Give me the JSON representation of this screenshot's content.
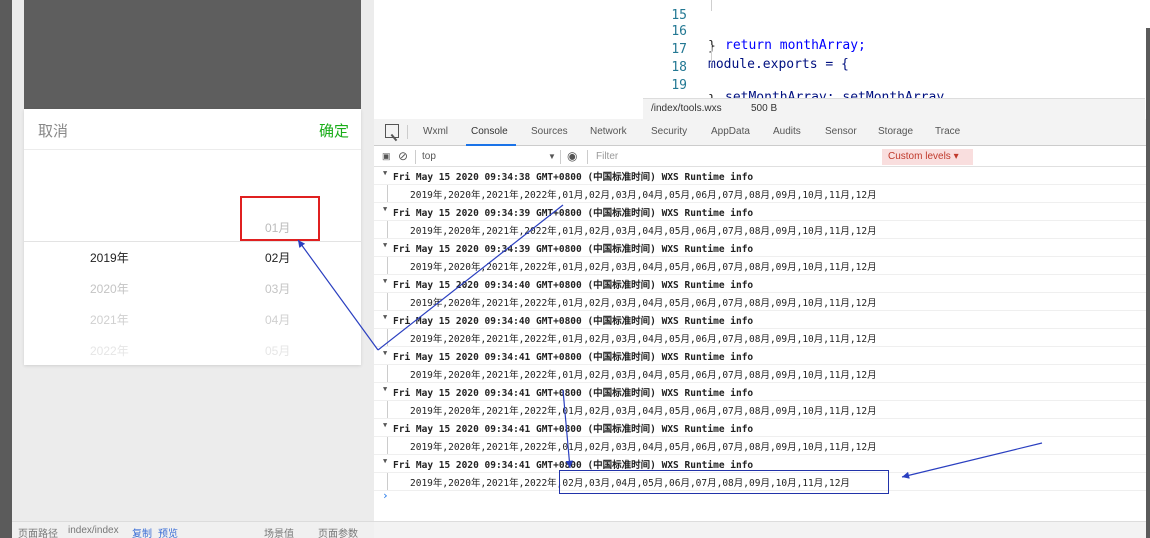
{
  "picker": {
    "cancel": "取消",
    "confirm": "确定",
    "selected_month_above": "01月",
    "rows": [
      {
        "year": "2019年",
        "month": "02月"
      },
      {
        "year": "2020年",
        "month": "03月"
      },
      {
        "year": "2021年",
        "month": "04月"
      },
      {
        "year": "2022年",
        "month": "05月"
      }
    ]
  },
  "sim_footer": {
    "path_label": "页面路径",
    "path": "index/index",
    "copy": "复制",
    "preview": "预览",
    "scene": "场景值",
    "params": "页面参数"
  },
  "editor": {
    "lines": [
      {
        "num": "15",
        "code": "return monthArray;"
      },
      {
        "num": "16",
        "code": "}"
      },
      {
        "num": "17",
        "code": "module.exports = {"
      },
      {
        "num": "18",
        "code": "setMonthArray: setMonthArray"
      },
      {
        "num": "19",
        "code": "}"
      }
    ],
    "file": "/index/tools.wxs",
    "size": "500 B"
  },
  "close_icon": "×",
  "devtools": {
    "tabs": [
      "Wxml",
      "Console",
      "Sources",
      "Network",
      "Security",
      "AppData",
      "Audits",
      "Sensor",
      "Storage",
      "Trace"
    ],
    "active_tab": "Console",
    "context": "top",
    "filter_placeholder": "Filter",
    "levels": "Custom levels ▾"
  },
  "console": {
    "logs": [
      {
        "header": "Fri May 15 2020 09:34:38 GMT+0800 (中国标准时间) WXS Runtime info",
        "body": "2019年,2020年,2021年,2022年,01月,02月,03月,04月,05月,06月,07月,08月,09月,10月,11月,12月"
      },
      {
        "header": "Fri May 15 2020 09:34:39 GMT+0800 (中国标准时间) WXS Runtime info",
        "body": "2019年,2020年,2021年,2022年,01月,02月,03月,04月,05月,06月,07月,08月,09月,10月,11月,12月"
      },
      {
        "header": "Fri May 15 2020 09:34:39 GMT+0800 (中国标准时间) WXS Runtime info",
        "body": "2019年,2020年,2021年,2022年,01月,02月,03月,04月,05月,06月,07月,08月,09月,10月,11月,12月"
      },
      {
        "header": "Fri May 15 2020 09:34:40 GMT+0800 (中国标准时间) WXS Runtime info",
        "body": "2019年,2020年,2021年,2022年,01月,02月,03月,04月,05月,06月,07月,08月,09月,10月,11月,12月"
      },
      {
        "header": "Fri May 15 2020 09:34:40 GMT+0800 (中国标准时间) WXS Runtime info",
        "body": "2019年,2020年,2021年,2022年,01月,02月,03月,04月,05月,06月,07月,08月,09月,10月,11月,12月"
      },
      {
        "header": "Fri May 15 2020 09:34:41 GMT+0800 (中国标准时间) WXS Runtime info",
        "body": "2019年,2020年,2021年,2022年,01月,02月,03月,04月,05月,06月,07月,08月,09月,10月,11月,12月"
      },
      {
        "header": "Fri May 15 2020 09:34:41 GMT+0800 (中国标准时间) WXS Runtime info",
        "body": "2019年,2020年,2021年,2022年,01月,02月,03月,04月,05月,06月,07月,08月,09月,10月,11月,12月"
      },
      {
        "header": "Fri May 15 2020 09:34:41 GMT+0800 (中国标准时间) WXS Runtime info",
        "body": "2019年,2020年,2021年,2022年,01月,02月,03月,04月,05月,06月,07月,08月,09月,10月,11月,12月"
      },
      {
        "header": "Fri May 15 2020 09:34:41 GMT+0800 (中国标准时间) WXS Runtime info",
        "body": "2019年,2020年,2021年,2022年,02月,03月,04月,05月,06月,07月,08月,09月,10月,11月,12月"
      }
    ],
    "prompt": "›"
  },
  "colors": {
    "confirm": "#1aad19",
    "annotation_red": "#e02020",
    "annotation_blue": "#2233aa"
  }
}
